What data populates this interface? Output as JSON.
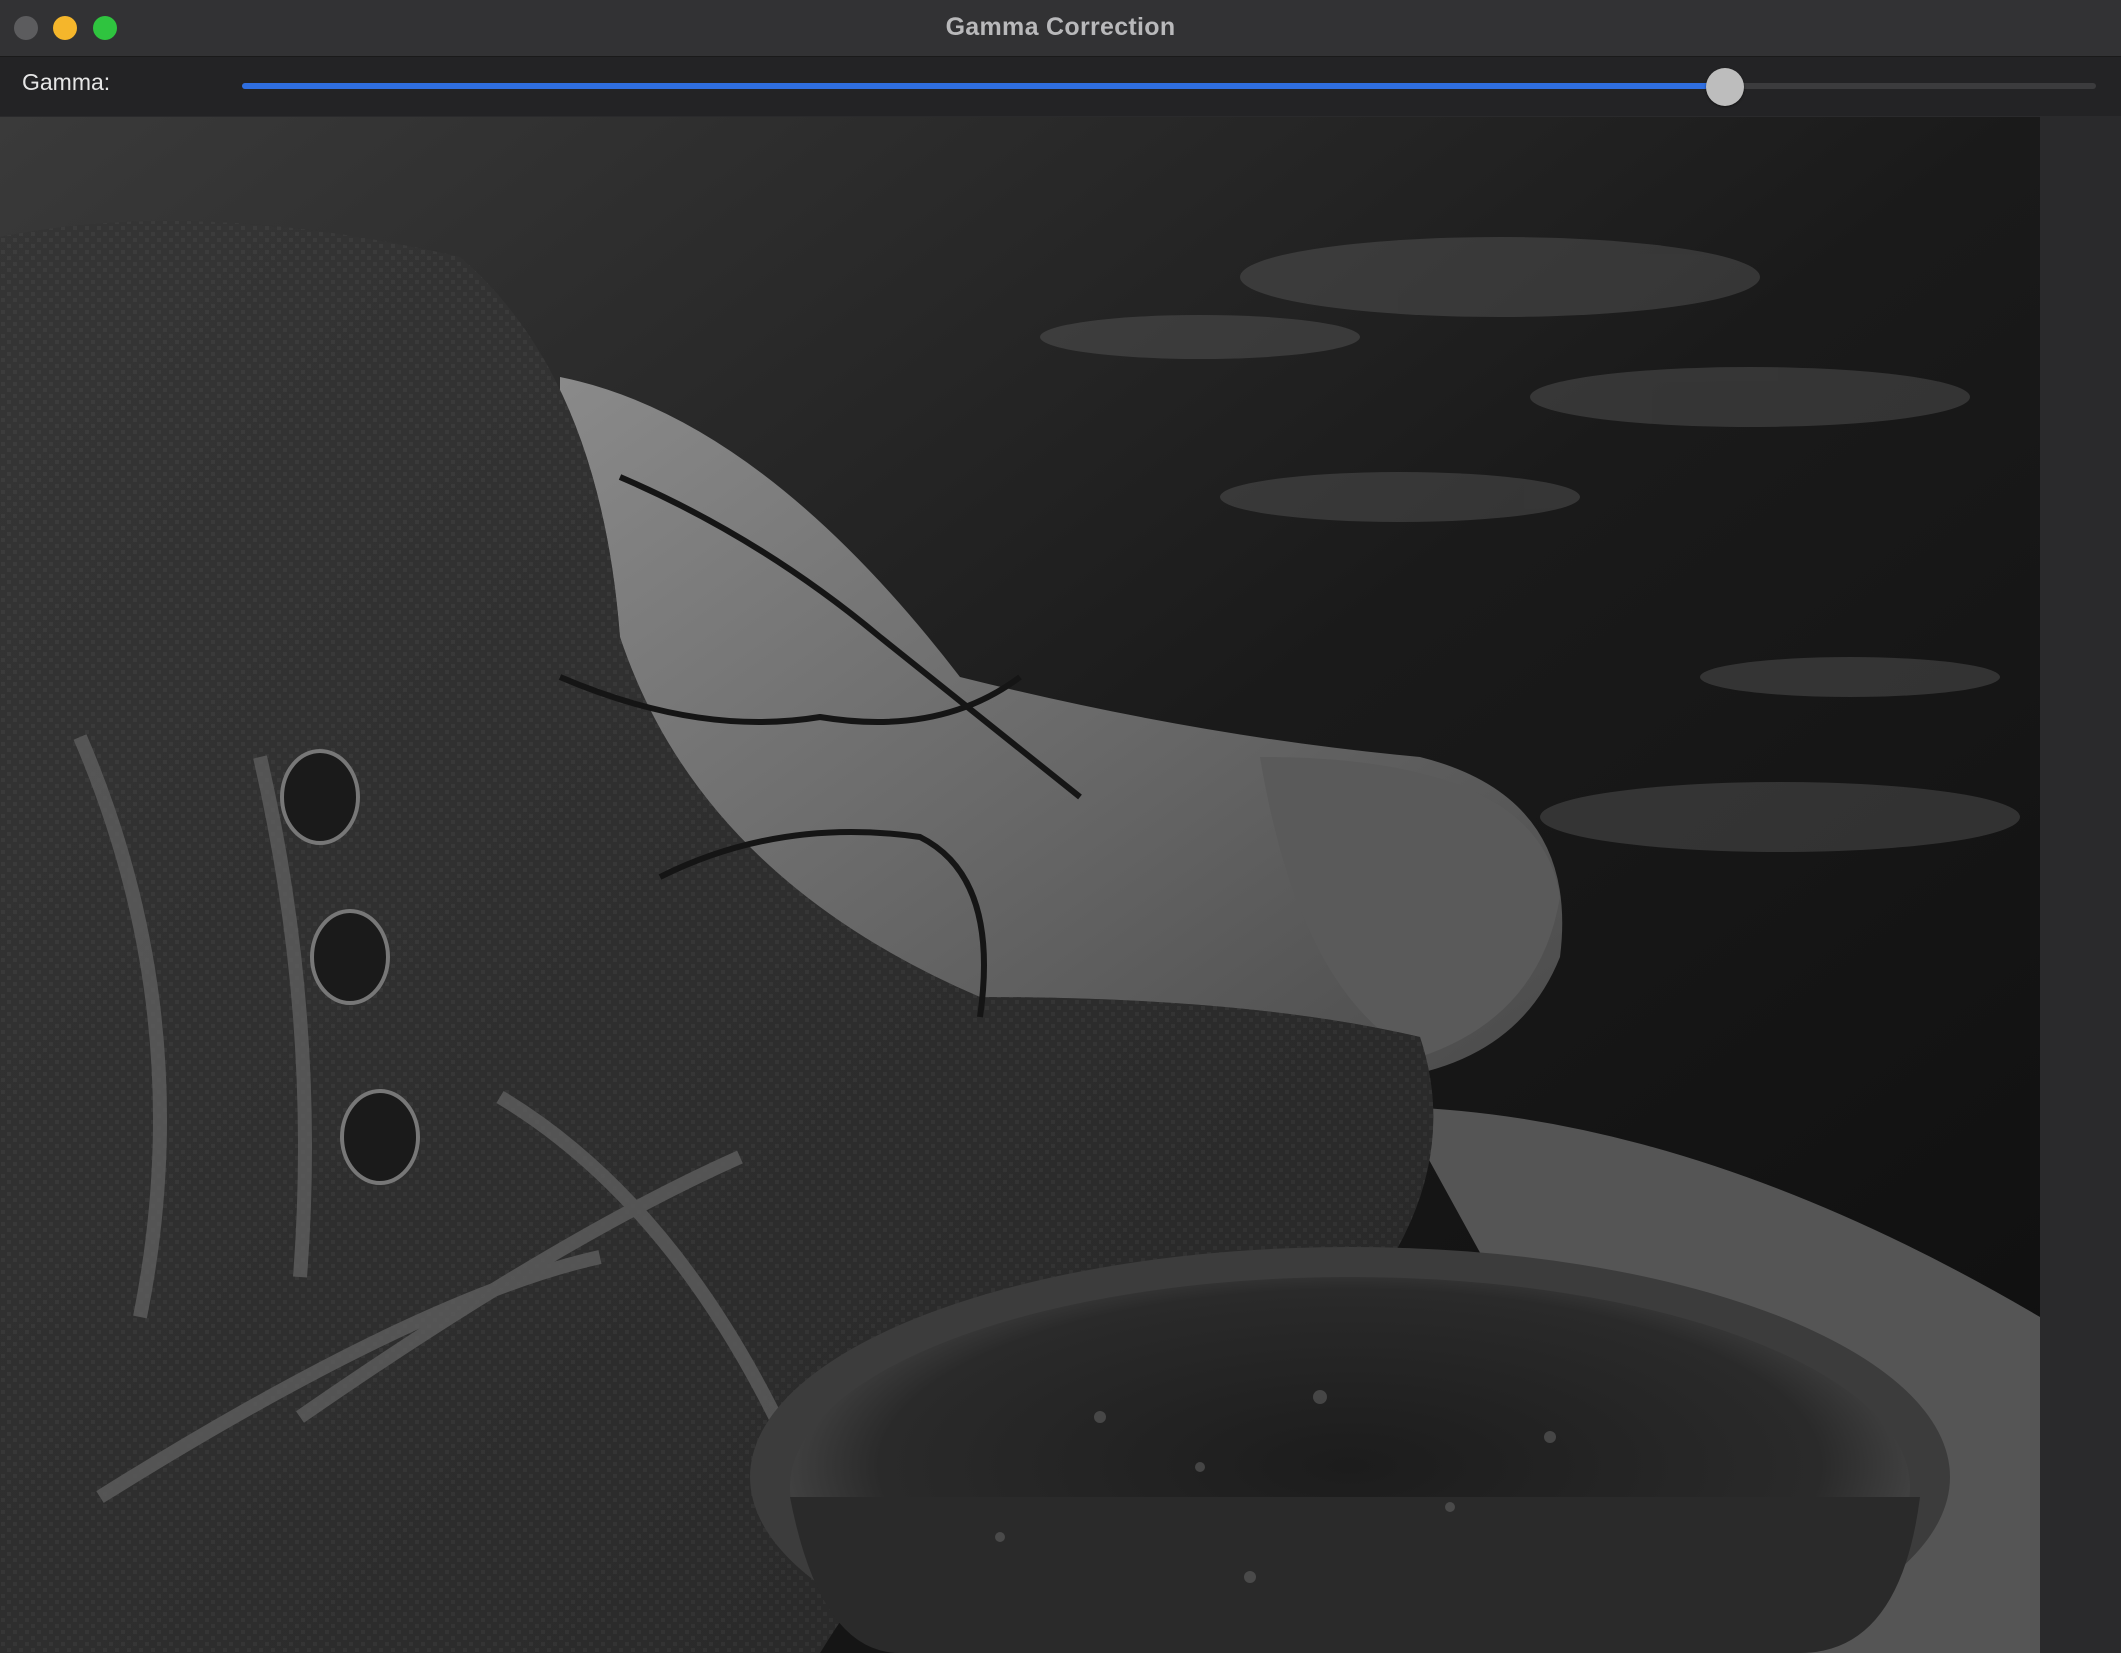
{
  "window": {
    "title": "Gamma Correction"
  },
  "controls": {
    "gamma_label": "Gamma:",
    "gamma_slider": {
      "position_fraction": 0.8,
      "accent_color": "#2f6ee0"
    }
  },
  "image": {
    "description_icon": "photo-preview",
    "mode": "grayscale"
  }
}
